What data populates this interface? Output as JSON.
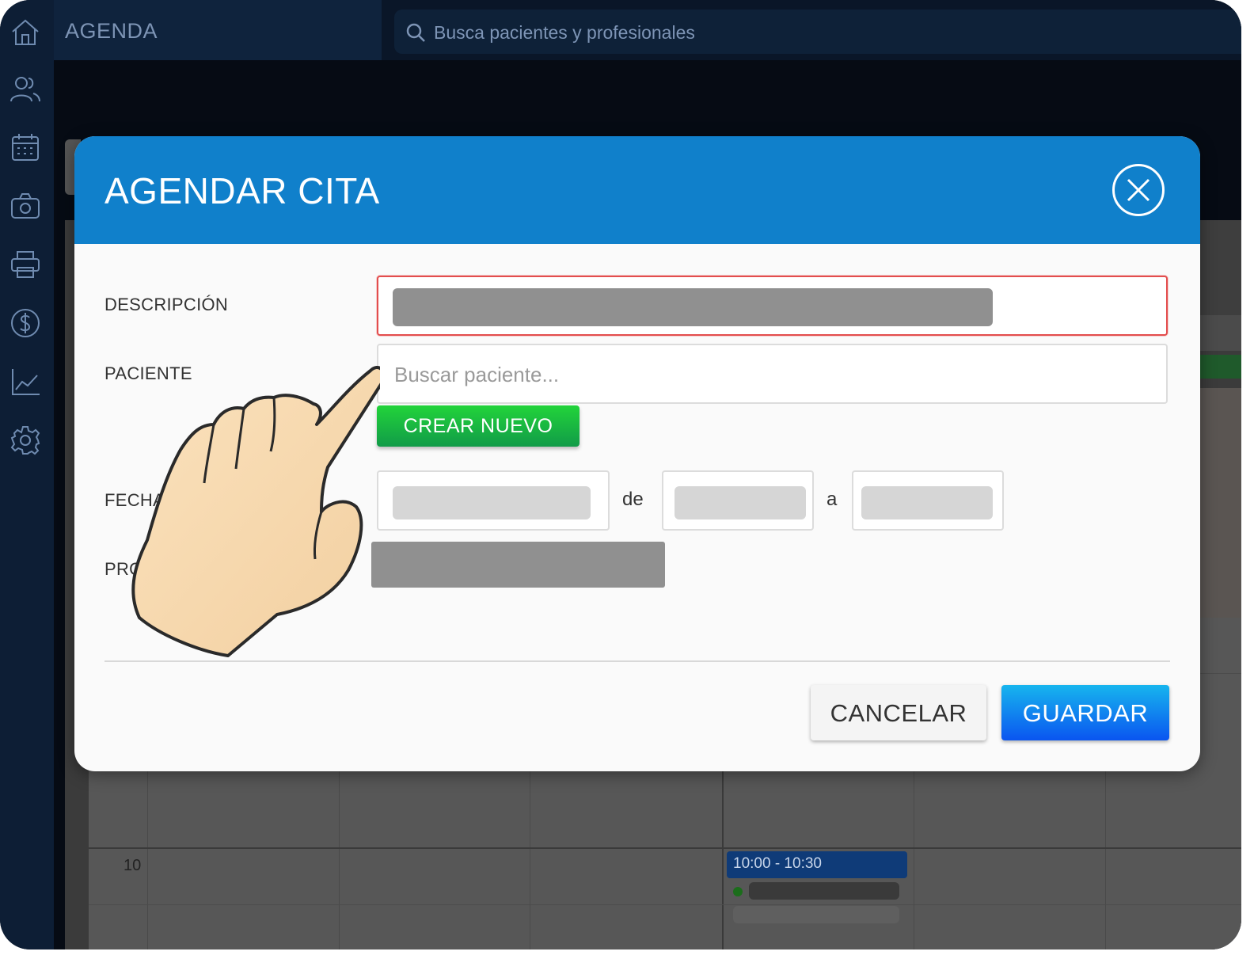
{
  "topbar": {
    "section_title": "AGENDA",
    "search_placeholder": "Busca pacientes y profesionales"
  },
  "sidebar": {
    "icons": [
      "home-icon",
      "patients-icon",
      "calendar-icon",
      "camera-icon",
      "printer-icon",
      "dollar-icon",
      "chart-icon",
      "gear-icon"
    ]
  },
  "calendar": {
    "hour_label": "10",
    "appointment_time": "10:00 - 10:30"
  },
  "modal": {
    "title": "AGENDAR CITA",
    "description_label": "DESCRIPCIÓN",
    "patient_label": "PACIENTE",
    "patient_placeholder": "Buscar paciente...",
    "create_new_label": "CREAR NUEVO",
    "date_label": "FECHA",
    "date_from_sep": "de",
    "date_to_sep": "a",
    "professional_label": "PRO",
    "cancel_label": "CANCELAR",
    "save_label": "GUARDAR"
  },
  "colors": {
    "header_blue": "#1080cb",
    "save_blue": "#0a55f0",
    "create_green": "#22d43a",
    "error_border": "#e34d4d",
    "sidebar_bg": "#0d1e35"
  }
}
